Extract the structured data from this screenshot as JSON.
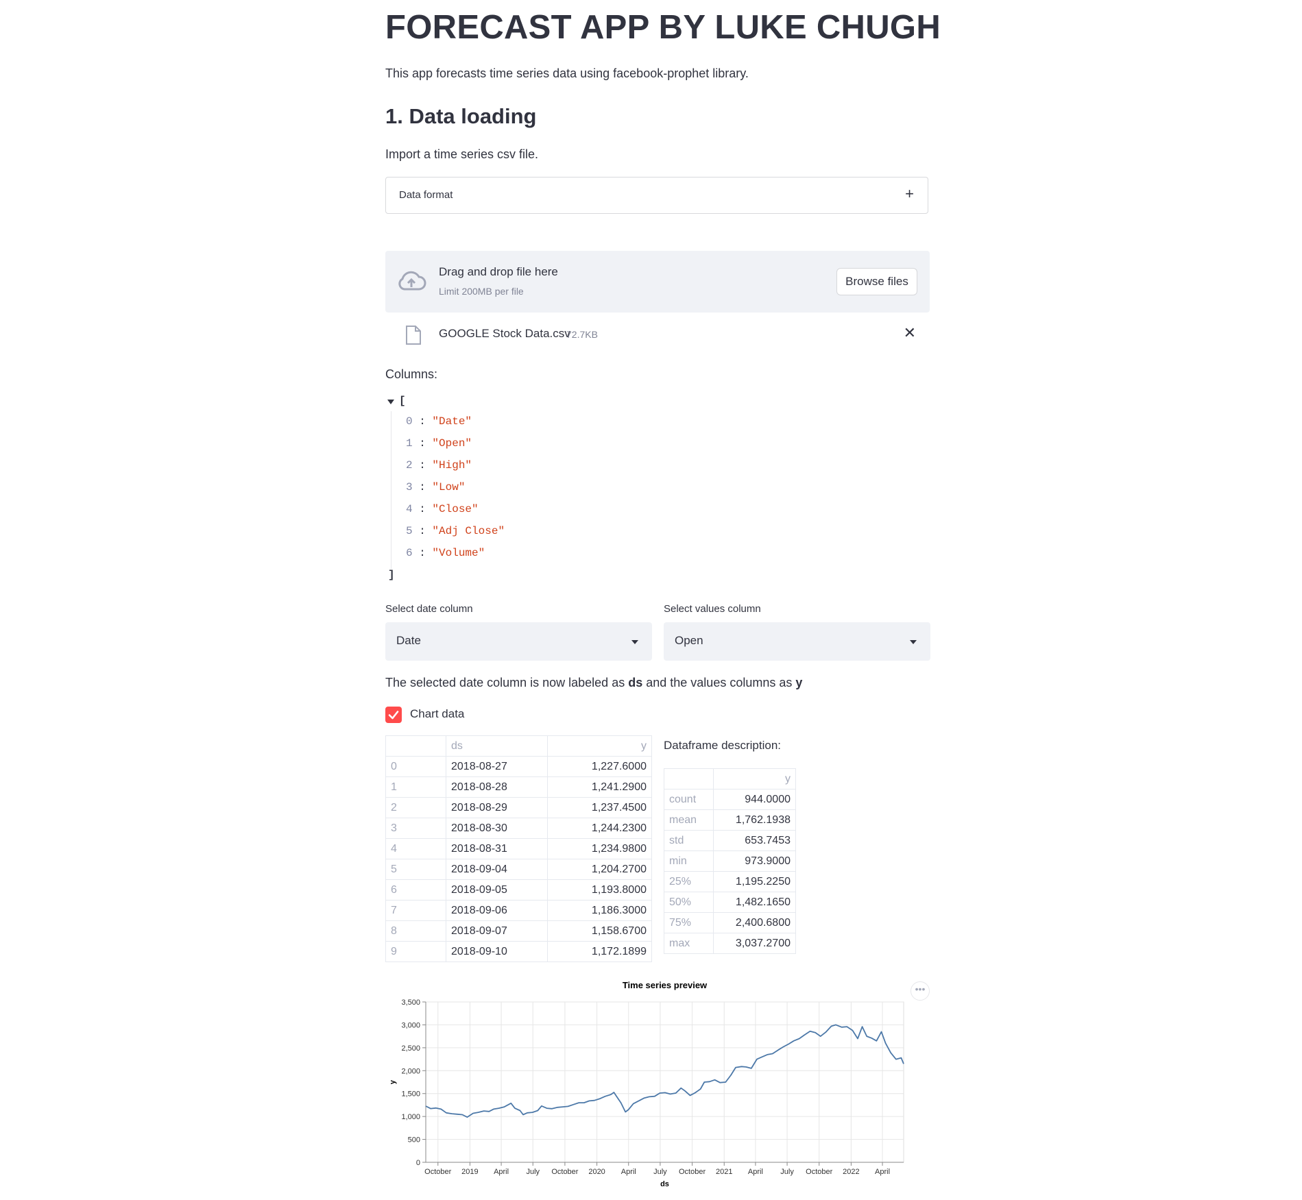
{
  "title": "FORECAST APP BY LUKE CHUGH",
  "intro": "This app forecasts time series data using facebook-prophet library.",
  "section1": {
    "heading": "1. Data loading",
    "import_text": "Import a time series csv file.",
    "expander_label": "Data format",
    "expander_icon": "+"
  },
  "uploader": {
    "drag_text": "Drag and drop file here",
    "limit_text": "Limit 200MB per file",
    "browse_label": "Browse files",
    "file_name": "GOOGLE Stock Data.csv",
    "file_size": "72.7KB",
    "remove_icon": "✕"
  },
  "columns": {
    "label": "Columns:",
    "open_bracket": "[",
    "close_bracket": "]",
    "items": [
      {
        "index": "0",
        "value": "\"Date\""
      },
      {
        "index": "1",
        "value": "\"Open\""
      },
      {
        "index": "2",
        "value": "\"High\""
      },
      {
        "index": "3",
        "value": "\"Low\""
      },
      {
        "index": "4",
        "value": "\"Close\""
      },
      {
        "index": "5",
        "value": "\"Adj Close\""
      },
      {
        "index": "6",
        "value": "\"Volume\""
      }
    ]
  },
  "selects": {
    "date_label": "Select date column",
    "date_value": "Date",
    "values_label": "Select values column",
    "values_value": "Open"
  },
  "labeled_note": {
    "prefix": "The selected date column is now labeled as ",
    "ds": "ds",
    "middle": " and the values columns as ",
    "y": "y"
  },
  "chart_checkbox": {
    "label": "Chart data",
    "checked": true,
    "color": "#ff4b4b"
  },
  "data_table": {
    "headers": [
      "",
      "ds",
      "y"
    ],
    "rows": [
      [
        "0",
        "2018-08-27",
        "1,227.6000"
      ],
      [
        "1",
        "2018-08-28",
        "1,241.2900"
      ],
      [
        "2",
        "2018-08-29",
        "1,237.4500"
      ],
      [
        "3",
        "2018-08-30",
        "1,244.2300"
      ],
      [
        "4",
        "2018-08-31",
        "1,234.9800"
      ],
      [
        "5",
        "2018-09-04",
        "1,204.2700"
      ],
      [
        "6",
        "2018-09-05",
        "1,193.8000"
      ],
      [
        "7",
        "2018-09-06",
        "1,186.3000"
      ],
      [
        "8",
        "2018-09-07",
        "1,158.6700"
      ],
      [
        "9",
        "2018-09-10",
        "1,172.1899"
      ]
    ]
  },
  "description": {
    "label": "Dataframe description:",
    "headers": [
      "",
      "y"
    ],
    "rows": [
      [
        "count",
        "944.0000"
      ],
      [
        "mean",
        "1,762.1938"
      ],
      [
        "std",
        "653.7453"
      ],
      [
        "min",
        "973.9000"
      ],
      [
        "25%",
        "1,195.2250"
      ],
      [
        "50%",
        "1,482.1650"
      ],
      [
        "75%",
        "2,400.6800"
      ],
      [
        "max",
        "3,037.2700"
      ]
    ]
  },
  "chart_menu": "•••",
  "chart_data": {
    "type": "line",
    "title": "Time series preview",
    "xlabel": "ds",
    "ylabel": "y",
    "ylim": [
      0,
      3500
    ],
    "yticks": [
      0,
      500,
      1000,
      1500,
      2000,
      2500,
      3000,
      3500
    ],
    "ytick_labels": [
      "0",
      "500",
      "1,000",
      "1,500",
      "2,000",
      "2,500",
      "3,000",
      "3,500"
    ],
    "xlim": [
      "2018-08-27",
      "2022-06-01"
    ],
    "xticks": [
      "2018-10-01",
      "2019-01-01",
      "2019-04-01",
      "2019-07-01",
      "2019-10-01",
      "2020-01-01",
      "2020-04-01",
      "2020-07-01",
      "2020-10-01",
      "2021-01-01",
      "2021-04-01",
      "2021-07-01",
      "2021-10-01",
      "2022-01-01",
      "2022-04-01"
    ],
    "xtick_labels": [
      "October",
      "2019",
      "April",
      "July",
      "October",
      "2020",
      "April",
      "July",
      "October",
      "2021",
      "April",
      "July",
      "October",
      "2022",
      "April"
    ],
    "grid": true,
    "line_color": "#4c78a8",
    "series": [
      {
        "x": [
          "2018-08-27",
          "2018-09-10",
          "2018-09-25",
          "2018-10-10",
          "2018-10-25",
          "2018-11-10",
          "2018-11-25",
          "2018-12-10",
          "2018-12-24",
          "2019-01-10",
          "2019-01-25",
          "2019-02-10",
          "2019-02-25",
          "2019-03-10",
          "2019-03-25",
          "2019-04-10",
          "2019-04-29",
          "2019-05-10",
          "2019-05-25",
          "2019-06-03",
          "2019-06-15",
          "2019-06-30",
          "2019-07-15",
          "2019-07-26",
          "2019-08-10",
          "2019-08-25",
          "2019-09-10",
          "2019-09-25",
          "2019-10-10",
          "2019-10-25",
          "2019-11-10",
          "2019-11-25",
          "2019-12-10",
          "2019-12-25",
          "2020-01-10",
          "2020-01-25",
          "2020-02-10",
          "2020-02-19",
          "2020-03-01",
          "2020-03-10",
          "2020-03-23",
          "2020-04-01",
          "2020-04-15",
          "2020-04-30",
          "2020-05-15",
          "2020-05-30",
          "2020-06-15",
          "2020-06-30",
          "2020-07-15",
          "2020-07-30",
          "2020-08-15",
          "2020-08-30",
          "2020-09-10",
          "2020-09-25",
          "2020-10-10",
          "2020-10-25",
          "2020-11-05",
          "2020-11-20",
          "2020-12-05",
          "2020-12-20",
          "2021-01-05",
          "2021-01-20",
          "2021-02-03",
          "2021-02-20",
          "2021-03-05",
          "2021-03-20",
          "2021-04-05",
          "2021-04-20",
          "2021-05-05",
          "2021-05-20",
          "2021-06-05",
          "2021-06-20",
          "2021-07-05",
          "2021-07-20",
          "2021-08-05",
          "2021-08-20",
          "2021-09-05",
          "2021-09-20",
          "2021-10-05",
          "2021-10-20",
          "2021-11-05",
          "2021-11-18",
          "2021-12-05",
          "2021-12-20",
          "2022-01-05",
          "2022-01-20",
          "2022-02-02",
          "2022-02-15",
          "2022-03-01",
          "2022-03-15",
          "2022-03-29",
          "2022-04-10",
          "2022-04-25",
          "2022-05-10",
          "2022-05-25",
          "2022-06-01"
        ],
        "y": [
          1227,
          1172,
          1185,
          1160,
          1080,
          1060,
          1050,
          1040,
          985,
          1070,
          1090,
          1120,
          1110,
          1160,
          1180,
          1210,
          1290,
          1180,
          1130,
          1040,
          1080,
          1090,
          1130,
          1230,
          1180,
          1170,
          1200,
          1210,
          1220,
          1260,
          1300,
          1300,
          1340,
          1350,
          1390,
          1440,
          1480,
          1525,
          1400,
          1300,
          1100,
          1150,
          1280,
          1340,
          1400,
          1430,
          1440,
          1510,
          1520,
          1490,
          1510,
          1620,
          1560,
          1460,
          1520,
          1600,
          1750,
          1760,
          1800,
          1740,
          1750,
          1900,
          2070,
          2090,
          2080,
          2050,
          2250,
          2300,
          2350,
          2370,
          2450,
          2520,
          2580,
          2650,
          2700,
          2780,
          2860,
          2830,
          2750,
          2840,
          2970,
          3000,
          2950,
          2960,
          2880,
          2700,
          2960,
          2750,
          2710,
          2650,
          2850,
          2600,
          2390,
          2250,
          2280,
          2150
        ]
      }
    ]
  }
}
